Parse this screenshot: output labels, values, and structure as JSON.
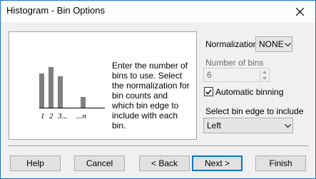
{
  "window": {
    "title": "Histogram - Bin Options",
    "close_icon": "close-icon"
  },
  "illustration": {
    "description": "Enter the number of bins to use. Select the normalization for bin counts and which bin edge to include with each bin.",
    "labels": [
      "1",
      "2",
      "3...",
      "...n"
    ]
  },
  "normalization": {
    "label": "Normalization",
    "value": "NONE"
  },
  "bins": {
    "label": "Number of bins",
    "value": "6"
  },
  "auto_binning": {
    "label": "Automatic binning",
    "checked": true
  },
  "bin_edge": {
    "label": "Select bin edge to include",
    "value": "Left"
  },
  "buttons": {
    "help": "Help",
    "cancel": "Cancel",
    "back": "< Back",
    "next": "Next >",
    "finish": "Finish"
  }
}
